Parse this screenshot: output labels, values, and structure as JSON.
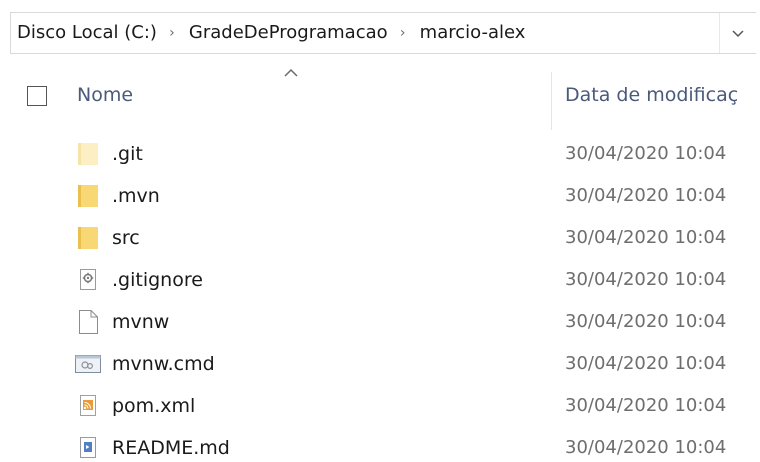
{
  "address_bar": {
    "crumbs": [
      "Disco Local (C:)",
      "GradeDeProgramacao",
      "marcio-alex"
    ],
    "separator": "›"
  },
  "columns": {
    "name_label": "Nome",
    "date_label": "Data de modificaç"
  },
  "files": [
    {
      "name": ".git",
      "date": "30/04/2020 10:04",
      "icon": "folder-faded-icon"
    },
    {
      "name": ".mvn",
      "date": "30/04/2020 10:04",
      "icon": "folder-icon"
    },
    {
      "name": "src",
      "date": "30/04/2020 10:04",
      "icon": "folder-icon"
    },
    {
      "name": ".gitignore",
      "date": "30/04/2020 10:04",
      "icon": "settings-file-icon"
    },
    {
      "name": "mvnw",
      "date": "30/04/2020 10:04",
      "icon": "blank-file-icon"
    },
    {
      "name": "mvnw.cmd",
      "date": "30/04/2020 10:04",
      "icon": "cmd-file-icon"
    },
    {
      "name": "pom.xml",
      "date": "30/04/2020 10:04",
      "icon": "xml-file-icon"
    },
    {
      "name": "README.md",
      "date": "30/04/2020 10:04",
      "icon": "md-file-icon"
    }
  ],
  "colors": {
    "folder": "#f8d775",
    "folder_faded": "#fcefc4",
    "header_text": "#4a5a7a",
    "date_text": "#6e6e6e"
  }
}
